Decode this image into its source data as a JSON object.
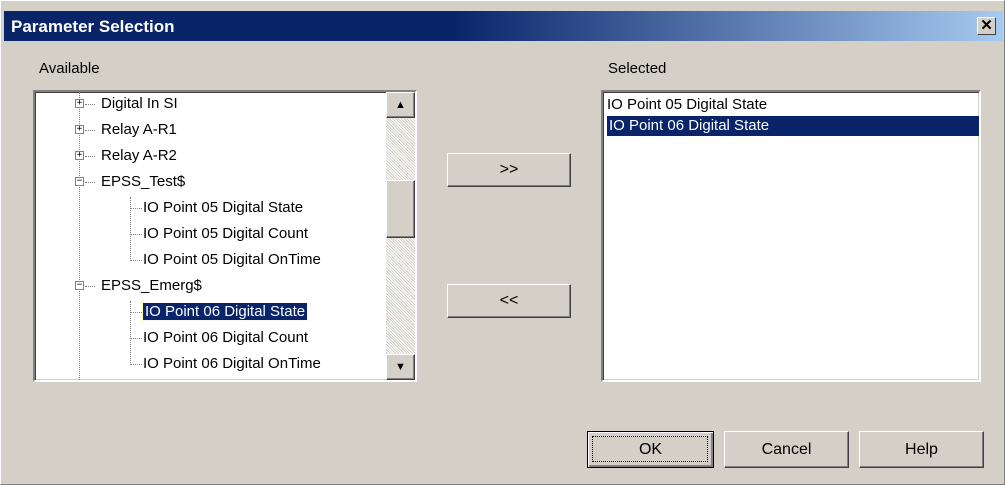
{
  "dialog": {
    "title": "Parameter Selection",
    "close_glyph": "✕"
  },
  "labels": {
    "available": "Available",
    "selected": "Selected"
  },
  "tree": {
    "items": [
      {
        "label": "Digital In SI",
        "expander": "+",
        "level": 1
      },
      {
        "label": "Relay A-R1",
        "expander": "+",
        "level": 1
      },
      {
        "label": "Relay A-R2",
        "expander": "+",
        "level": 1
      },
      {
        "label": "EPSS_Test$",
        "expander": "−",
        "level": 1
      },
      {
        "label": "IO Point 05 Digital State",
        "level": 2
      },
      {
        "label": "IO Point 05 Digital Count",
        "level": 2
      },
      {
        "label": "IO Point 05 Digital OnTime",
        "level": 2
      },
      {
        "label": "EPSS_Emerg$",
        "expander": "−",
        "level": 1
      },
      {
        "label": "IO Point 06 Digital State",
        "level": 2,
        "selected": true
      },
      {
        "label": "IO Point 06 Digital Count",
        "level": 2
      },
      {
        "label": "IO Point 06 Digital OnTime",
        "level": 2
      }
    ]
  },
  "scrollbar": {
    "up_glyph": "▲",
    "down_glyph": "▼"
  },
  "buttons": {
    "add": ">>",
    "remove": "<<",
    "ok": "OK",
    "cancel": "Cancel",
    "help": "Help"
  },
  "selected_list": {
    "items": [
      {
        "label": "IO Point 05 Digital State"
      },
      {
        "label": "IO Point 06 Digital State",
        "selected": true
      }
    ]
  },
  "colors": {
    "titlebar": "#0a246a",
    "selection": "#0a246a",
    "face": "#d4d0c8"
  }
}
